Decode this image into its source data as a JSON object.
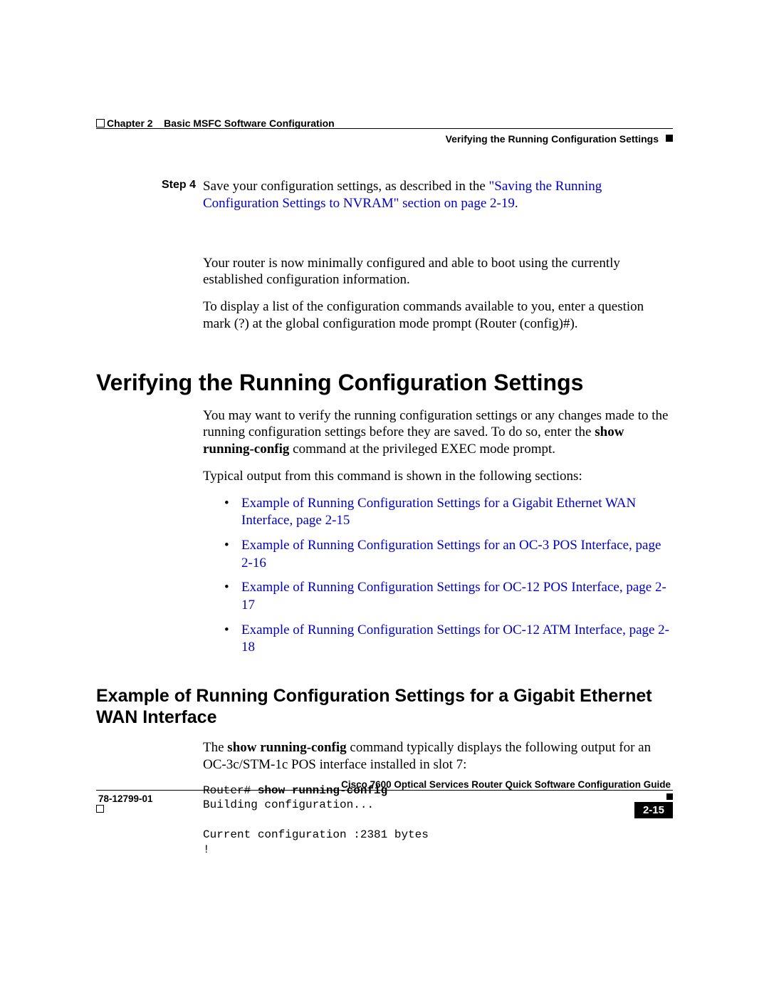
{
  "header": {
    "left": "Chapter 2    Basic MSFC Software Configuration",
    "right": "Verifying the Running Configuration Settings"
  },
  "step": {
    "label": "Step 4",
    "text_before": "Save your configuration settings, as described in the ",
    "link": "\"Saving the Running Configuration Settings to NVRAM\" section on page 2-19",
    "text_after": "."
  },
  "body": {
    "p1": "Your router is now minimally configured and able to boot using the currently established configuration information.",
    "p2": "To display a list of the configuration commands available to you, enter a question mark (?) at the global configuration mode prompt (Router (config)#)."
  },
  "h1": "Verifying the Running Configuration Settings",
  "intro": {
    "p1a": "You may want to verify the running configuration settings or any changes made to the running configuration settings before they are saved. To do so, enter the ",
    "p1b": "show running-config",
    "p1c": " command at the privileged EXEC mode prompt.",
    "p2": "Typical output from this command is shown in the following sections:"
  },
  "links": [
    "Example of Running Configuration Settings for a Gigabit Ethernet WAN Interface, page 2-15",
    "Example of Running Configuration Settings for an OC-3 POS Interface, page 2-16",
    "Example of Running Configuration Settings for OC-12 POS Interface, page 2-17",
    "Example of Running Configuration Settings for OC-12 ATM Interface, page 2-18"
  ],
  "h2": "Example of Running Configuration Settings for a Gigabit Ethernet WAN Interface",
  "example": {
    "p1a": "The ",
    "p1b": "show running-config",
    "p1c": " command typically displays the following output for an OC-3c/STM-1c POS interface installed in slot 7:"
  },
  "code": {
    "l1a": "Router# ",
    "l1b": "show running-config",
    "l2": "Building configuration...",
    "l3": "",
    "l4": "Current configuration :2381 bytes",
    "l5": "!"
  },
  "footer": {
    "title": "Cisco 7600 Optical Services Router Quick Software Configuration Guide",
    "docnum": "78-12799-01",
    "pagenum": "2-15"
  }
}
